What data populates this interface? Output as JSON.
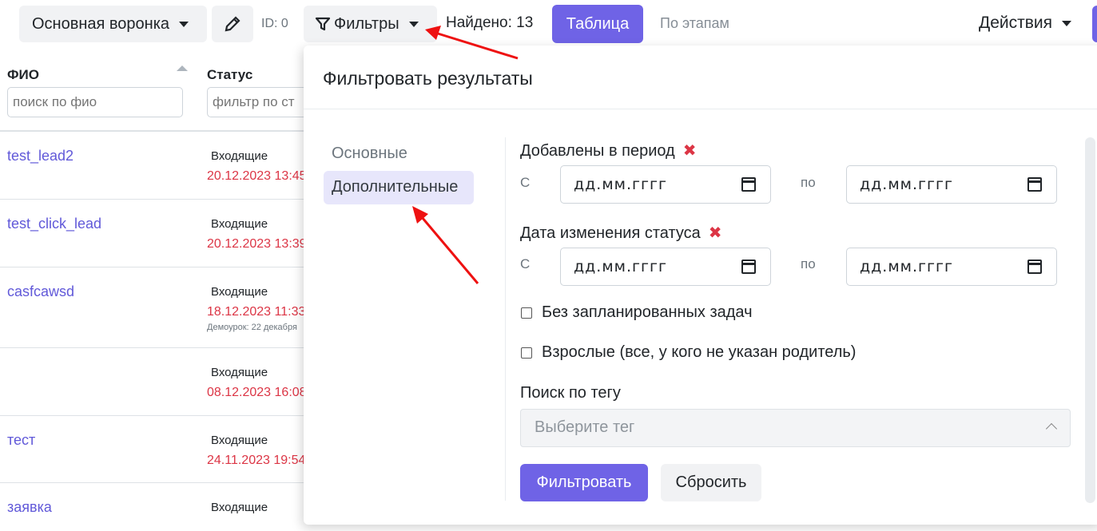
{
  "toolbar": {
    "pipeline_label": "Основная воронка",
    "id_label": "ID: 0",
    "filters_label": "Фильтры",
    "found_label": "Найдено: 13",
    "table_label": "Таблица",
    "stages_label": "По этапам",
    "actions_label": "Действия"
  },
  "table": {
    "col_fio": "ФИО",
    "col_status": "Статус",
    "fio_placeholder": "поиск по фио",
    "status_placeholder": "фильтр по ст",
    "rows": [
      {
        "name": "test_lead2",
        "status": "Входящие",
        "date": "20.12.2023 13:45",
        "note": ""
      },
      {
        "name": "test_click_lead",
        "status": "Входящие",
        "date": "20.12.2023 13:39",
        "note": ""
      },
      {
        "name": "casfcawsd",
        "status": "Входящие",
        "date": "18.12.2023 11:33",
        "note": "Демоурок: 22 декабря"
      },
      {
        "name": "",
        "status": "Входящие",
        "date": "08.12.2023 16:08",
        "note": ""
      },
      {
        "name": "тест",
        "status": "Входящие",
        "date": "24.11.2023 19:54",
        "note": ""
      },
      {
        "name": "заявка",
        "status": "Входящие",
        "date": "",
        "note": ""
      }
    ]
  },
  "filter_panel": {
    "title": "Фильтровать результаты",
    "nav": {
      "main": "Основные",
      "extra": "Дополнительные"
    },
    "added_period_label": "Добавлены в период",
    "status_change_label": "Дата изменения статуса",
    "from_label": "С",
    "to_label": "по",
    "date_placeholder": "дд.мм.гггг",
    "no_tasks_label": "Без запланированных задач",
    "adults_label": "Взрослые (все, у кого не указан родитель)",
    "tag_search_label": "Поиск по тегу",
    "tag_placeholder": "Выберите тег",
    "filter_button": "Фильтровать",
    "reset_button": "Сбросить"
  },
  "colors": {
    "accent": "#6f63e6",
    "annotation_arrow": "#ee1111",
    "date_red": "#dc3545",
    "link": "#6159d9"
  }
}
